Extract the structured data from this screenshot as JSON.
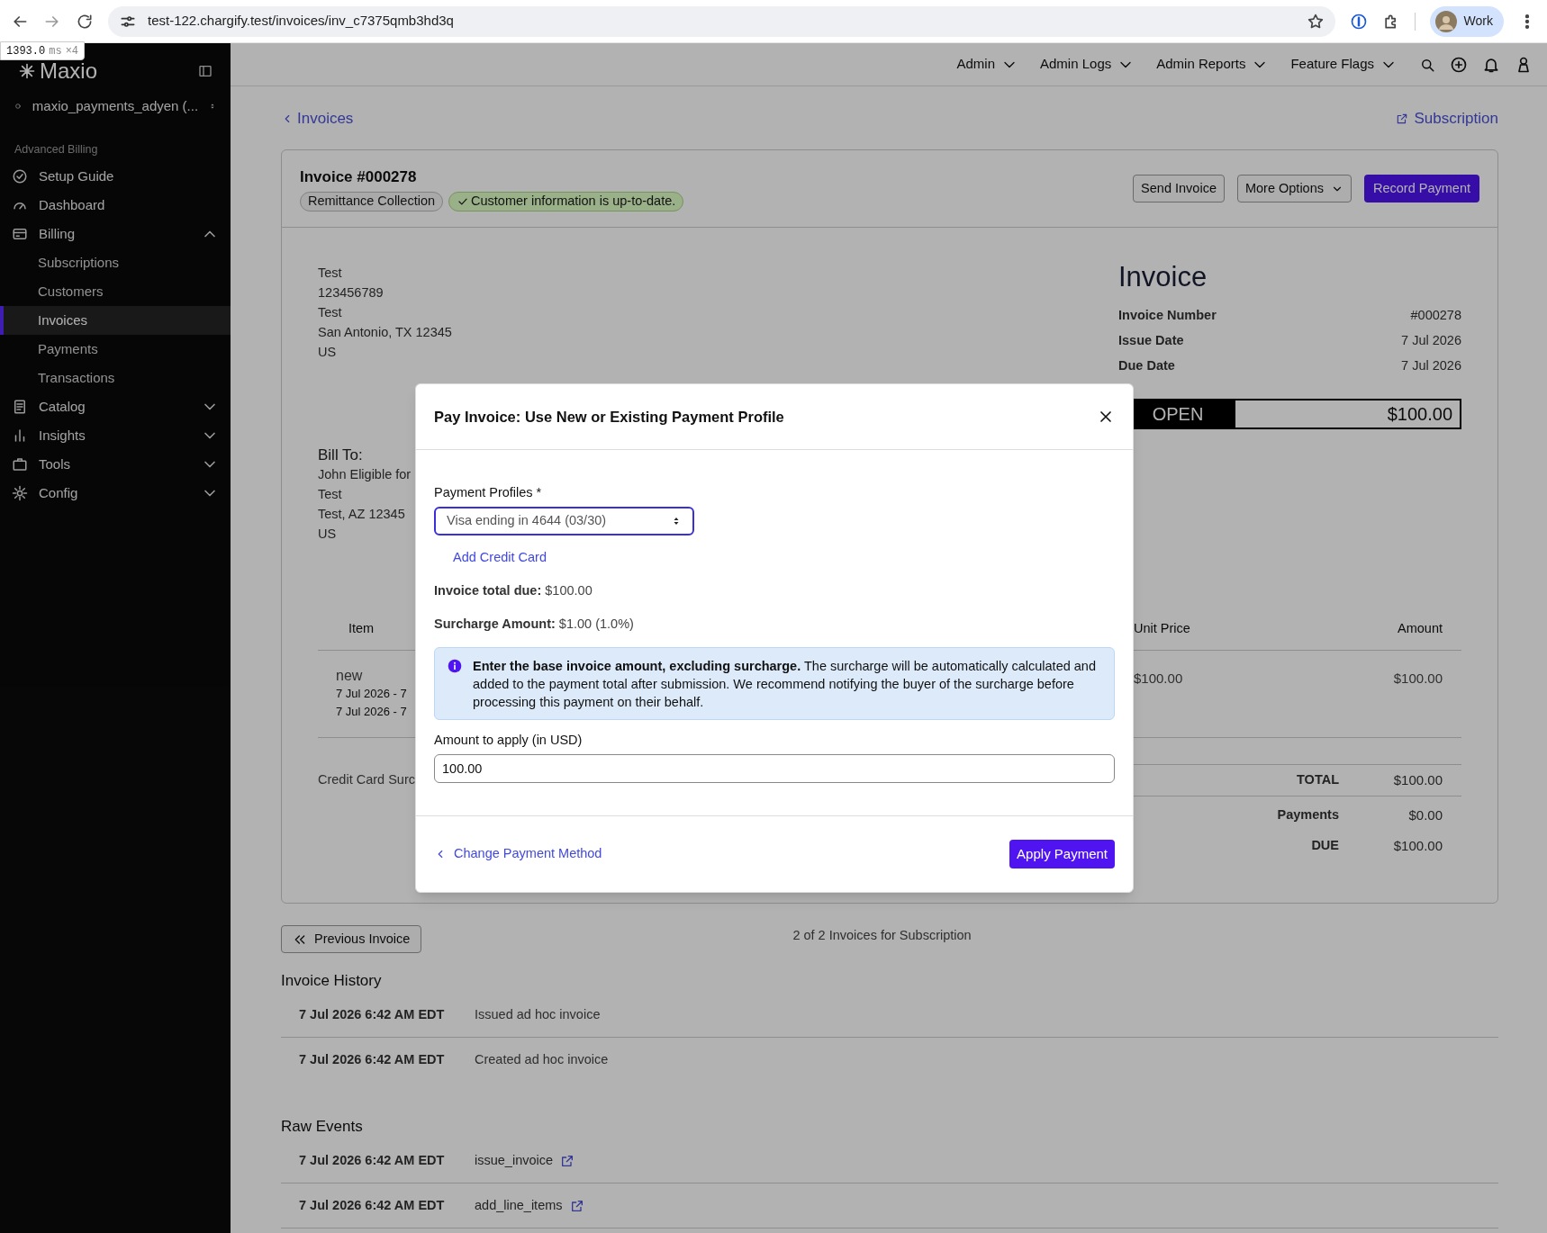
{
  "browser": {
    "url": "test-122.chargify.test/invoices/inv_c7375qmb3hd3q",
    "profile_label": "Work"
  },
  "perf_badge": {
    "value": "1393.0",
    "unit": "ms",
    "multiplier": "×4"
  },
  "sidebar": {
    "brand": "Maxio",
    "account": "maxio_payments_adyen (...",
    "section_label": "Advanced Billing",
    "items": [
      {
        "label": "Setup Guide"
      },
      {
        "label": "Dashboard"
      },
      {
        "label": "Billing",
        "expanded": true,
        "children": [
          {
            "label": "Subscriptions",
            "selected": false
          },
          {
            "label": "Customers",
            "selected": false
          },
          {
            "label": "Invoices",
            "selected": true
          },
          {
            "label": "Payments",
            "selected": false
          },
          {
            "label": "Transactions",
            "selected": false
          }
        ]
      },
      {
        "label": "Catalog",
        "expanded": false
      },
      {
        "label": "Insights",
        "expanded": false
      },
      {
        "label": "Tools",
        "expanded": false
      },
      {
        "label": "Config",
        "expanded": false
      }
    ]
  },
  "top_nav": {
    "menus": [
      "Admin",
      "Admin Logs",
      "Admin Reports",
      "Feature Flags"
    ]
  },
  "page": {
    "back_link": "Invoices",
    "subscription_link": "Subscription"
  },
  "invoice_card": {
    "title": "Invoice #000278",
    "badges": [
      {
        "label": "Remittance Collection",
        "kind": "neutral"
      },
      {
        "label": "Customer information is up-to-date.",
        "kind": "success"
      }
    ],
    "actions": [
      {
        "label": "Send Invoice",
        "kind": "secondary"
      },
      {
        "label": "More Options",
        "kind": "dropdown"
      },
      {
        "label": "Record Payment",
        "kind": "primary"
      }
    ],
    "seller_address": [
      "Test",
      "123456789",
      "Test",
      "San Antonio, TX 12345",
      "US"
    ],
    "heading": "Invoice",
    "details": [
      {
        "label": "Invoice Number",
        "value": "#000278"
      },
      {
        "label": "Issue Date",
        "value": "7 Jul 2026"
      },
      {
        "label": "Due Date",
        "value": "7 Jul 2026"
      }
    ],
    "status": {
      "label": "OPEN",
      "amount": "$100.00"
    },
    "bill_to": {
      "heading": "Bill To:",
      "lines": [
        "John Eligible for",
        "Test",
        "Test, AZ 12345",
        "US"
      ]
    },
    "table": {
      "columns": [
        "Item",
        "Unit Price",
        "Amount"
      ],
      "rows": [
        {
          "item": "new",
          "periods": [
            "7 Jul 2026 - 7",
            "7 Jul 2026 - 7"
          ],
          "unit_price": "$100.00",
          "amount": "$100.00"
        }
      ],
      "surcharge_label": "Credit Card Surc"
    },
    "totals": [
      {
        "label": "TOTAL",
        "value": "$100.00"
      },
      {
        "label": "Payments",
        "value": "$0.00"
      },
      {
        "label": "DUE",
        "value": "$100.00"
      }
    ]
  },
  "pager": {
    "previous": "Previous Invoice",
    "summary": "2 of 2 Invoices for Subscription"
  },
  "invoice_history": {
    "heading": "Invoice History",
    "rows": [
      {
        "time": "7 Jul 2026 6:42 AM EDT",
        "text": "Issued ad hoc invoice"
      },
      {
        "time": "7 Jul 2026 6:42 AM EDT",
        "text": "Created ad hoc invoice"
      }
    ]
  },
  "raw_events": {
    "heading": "Raw Events",
    "rows": [
      {
        "time": "7 Jul 2026 6:42 AM EDT",
        "event": "issue_invoice"
      },
      {
        "time": "7 Jul 2026 6:42 AM EDT",
        "event": "add_line_items"
      }
    ]
  },
  "modal": {
    "title": "Pay Invoice: Use New or Existing Payment Profile",
    "profile_label": "Payment Profiles",
    "required_mark": "*",
    "profile_value": "Visa ending in 4644 (03/30)",
    "add_card_link": "Add Credit Card",
    "summary": [
      {
        "label": "Invoice total due:",
        "value": "$100.00"
      },
      {
        "label": "Surcharge Amount:",
        "value": "$1.00 (1.0%)"
      }
    ],
    "notice": "**Enter the base invoice amount, excluding surcharge.** The surcharge will be automatically calculated and added to the payment total after submission. We recommend notifying the buyer of the surcharge before processing this payment on their behalf.",
    "amount_label": "Amount to apply (in USD)",
    "amount_value": "100.00",
    "back_link": "Change Payment Method",
    "submit": "Apply Payment"
  }
}
